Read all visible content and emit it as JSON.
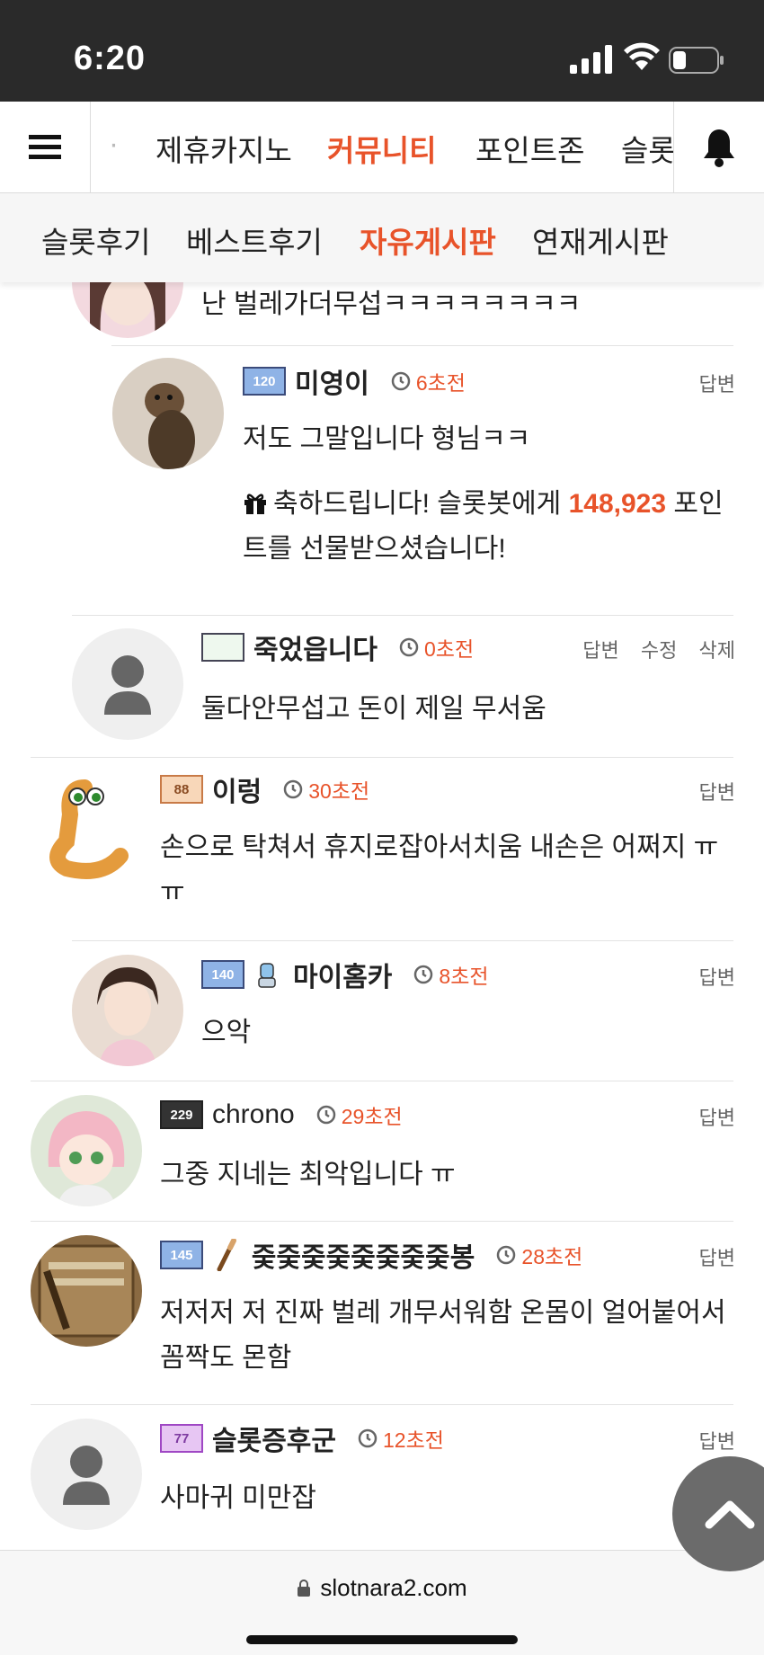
{
  "status_bar": {
    "time": "6:20"
  },
  "top_nav": {
    "items": [
      {
        "label": "·"
      },
      {
        "label": "제휴카지노"
      },
      {
        "label": "커뮤니티",
        "active": true
      },
      {
        "label": "포인트존"
      },
      {
        "label": "슬롯"
      }
    ]
  },
  "sub_nav": {
    "items": [
      {
        "label": "슬롯후기"
      },
      {
        "label": "베스트후기"
      },
      {
        "label": "자유게시판",
        "active": true
      },
      {
        "label": "연재게시판"
      }
    ]
  },
  "comments": [
    {
      "text": "난 벌레가더무섭ㅋㅋㅋㅋㅋㅋㅋㅋ"
    },
    {
      "level": "120",
      "nickname": "미영이",
      "time": "6초전",
      "actions": [
        "답변"
      ],
      "text": "저도 그말입니다 형님ㅋㅋ",
      "gift": {
        "prefix": "축하드립니다! 슬롯봇에게 ",
        "points": "148,923",
        "suffix_1": " 포인",
        "suffix_2": "트를 선물받으셨습니다!"
      }
    },
    {
      "nickname": "죽었읍니다",
      "time": "0초전",
      "actions": [
        "답변",
        "수정",
        "삭제"
      ],
      "text": "둘다안무섭고 돈이 제일 무서움"
    },
    {
      "level": "88",
      "nickname": "이렁",
      "time": "30초전",
      "actions": [
        "답변"
      ],
      "text_1": "손으로 탁쳐서 휴지로잡아서치움 내손은 어쩌지 ㅠ",
      "text_2": "ㅠ"
    },
    {
      "level": "140",
      "nickname": "마이홈카",
      "time": "8초전",
      "actions": [
        "답변"
      ],
      "text": "으악"
    },
    {
      "level": "229",
      "nickname": "chrono",
      "time": "29초전",
      "actions": [
        "답변"
      ],
      "text": "그중 지네는 최악입니다 ㅠ"
    },
    {
      "level": "145",
      "nickname": "줒줒줒줒줒줒줒줒봉",
      "time": "28초전",
      "actions": [
        "답변"
      ],
      "text_1": "저저저 저 진짜 벌레 개무서워함 온몸이 얼어붙어서",
      "text_2": "꼼짝도 몬함"
    },
    {
      "level": "77",
      "nickname": "슬롯증후군",
      "time": "12초전",
      "actions": [
        "답변"
      ],
      "text": "사마귀 미만잡"
    }
  ],
  "url_bar": {
    "domain": "slotnara2.com"
  },
  "colors": {
    "accent": "#e8532a",
    "status_bar": "#2a2a2a",
    "scroll_button": "#6b6b6b"
  },
  "icons": [
    "menu-icon",
    "bell-icon",
    "clock-icon",
    "gift-icon",
    "lock-icon",
    "chevron-up-icon"
  ]
}
